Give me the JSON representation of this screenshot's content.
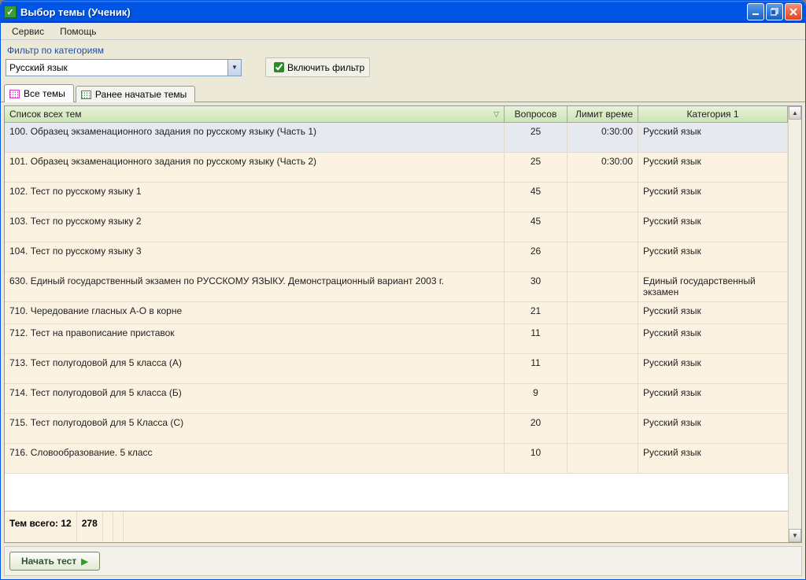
{
  "window": {
    "title": "Выбор темы (Ученик)"
  },
  "menu": {
    "service": "Сервис",
    "help": "Помощь"
  },
  "filter": {
    "label": "Фильтр по категориям",
    "value": "Русский язык",
    "enable_label": "Включить фильтр"
  },
  "tabs": {
    "all": "Все темы",
    "started": "Ранее начатые темы"
  },
  "columns": {
    "list": "Список всех тем",
    "questions": "Вопросов",
    "limit": "Лимит време",
    "category": "Категория 1"
  },
  "rows": [
    {
      "name": "100. Образец экзаменационного задания по русскому языку (Часть 1)",
      "q": "25",
      "limit": "0:30:00",
      "cat": "Русский язык",
      "selected": true
    },
    {
      "name": "101. Образец экзаменационного задания по русскому языку (Часть 2)",
      "q": "25",
      "limit": "0:30:00",
      "cat": "Русский язык"
    },
    {
      "name": "102. Тест по русскому языку 1",
      "q": "45",
      "limit": "",
      "cat": "Русский язык"
    },
    {
      "name": "103. Тест по русскому языку 2",
      "q": "45",
      "limit": "",
      "cat": "Русский язык"
    },
    {
      "name": "104. Тест по русскому языку 3",
      "q": "26",
      "limit": "",
      "cat": "Русский язык"
    },
    {
      "name": "630. Единый государственный экзамен по РУССКОМУ ЯЗЫКУ. Демонстрационный вариант 2003 г.",
      "q": "30",
      "limit": "",
      "cat": "Единый государственный экзамен"
    },
    {
      "name": "710. Чередование гласных А-О в корне",
      "q": "21",
      "limit": "",
      "cat": "Русский язык",
      "small": true
    },
    {
      "name": "712. Тест на правописание приставок",
      "q": "11",
      "limit": "",
      "cat": "Русский язык"
    },
    {
      "name": "713. Тест полугодовой для 5 класса (А)",
      "q": "11",
      "limit": "",
      "cat": "Русский язык"
    },
    {
      "name": "714. Тест полугодовой для 5 класса (Б)",
      "q": "9",
      "limit": "",
      "cat": "Русский язык"
    },
    {
      "name": "715. Тест полугодовой для 5 Класса (С)",
      "q": "20",
      "limit": "",
      "cat": "Русский язык"
    },
    {
      "name": "716. Словообразование. 5 класс",
      "q": "10",
      "limit": "",
      "cat": "Русский язык"
    }
  ],
  "footer": {
    "total_label": "Тем всего: 12",
    "total_q": "278"
  },
  "buttons": {
    "start": "Начать тест"
  }
}
